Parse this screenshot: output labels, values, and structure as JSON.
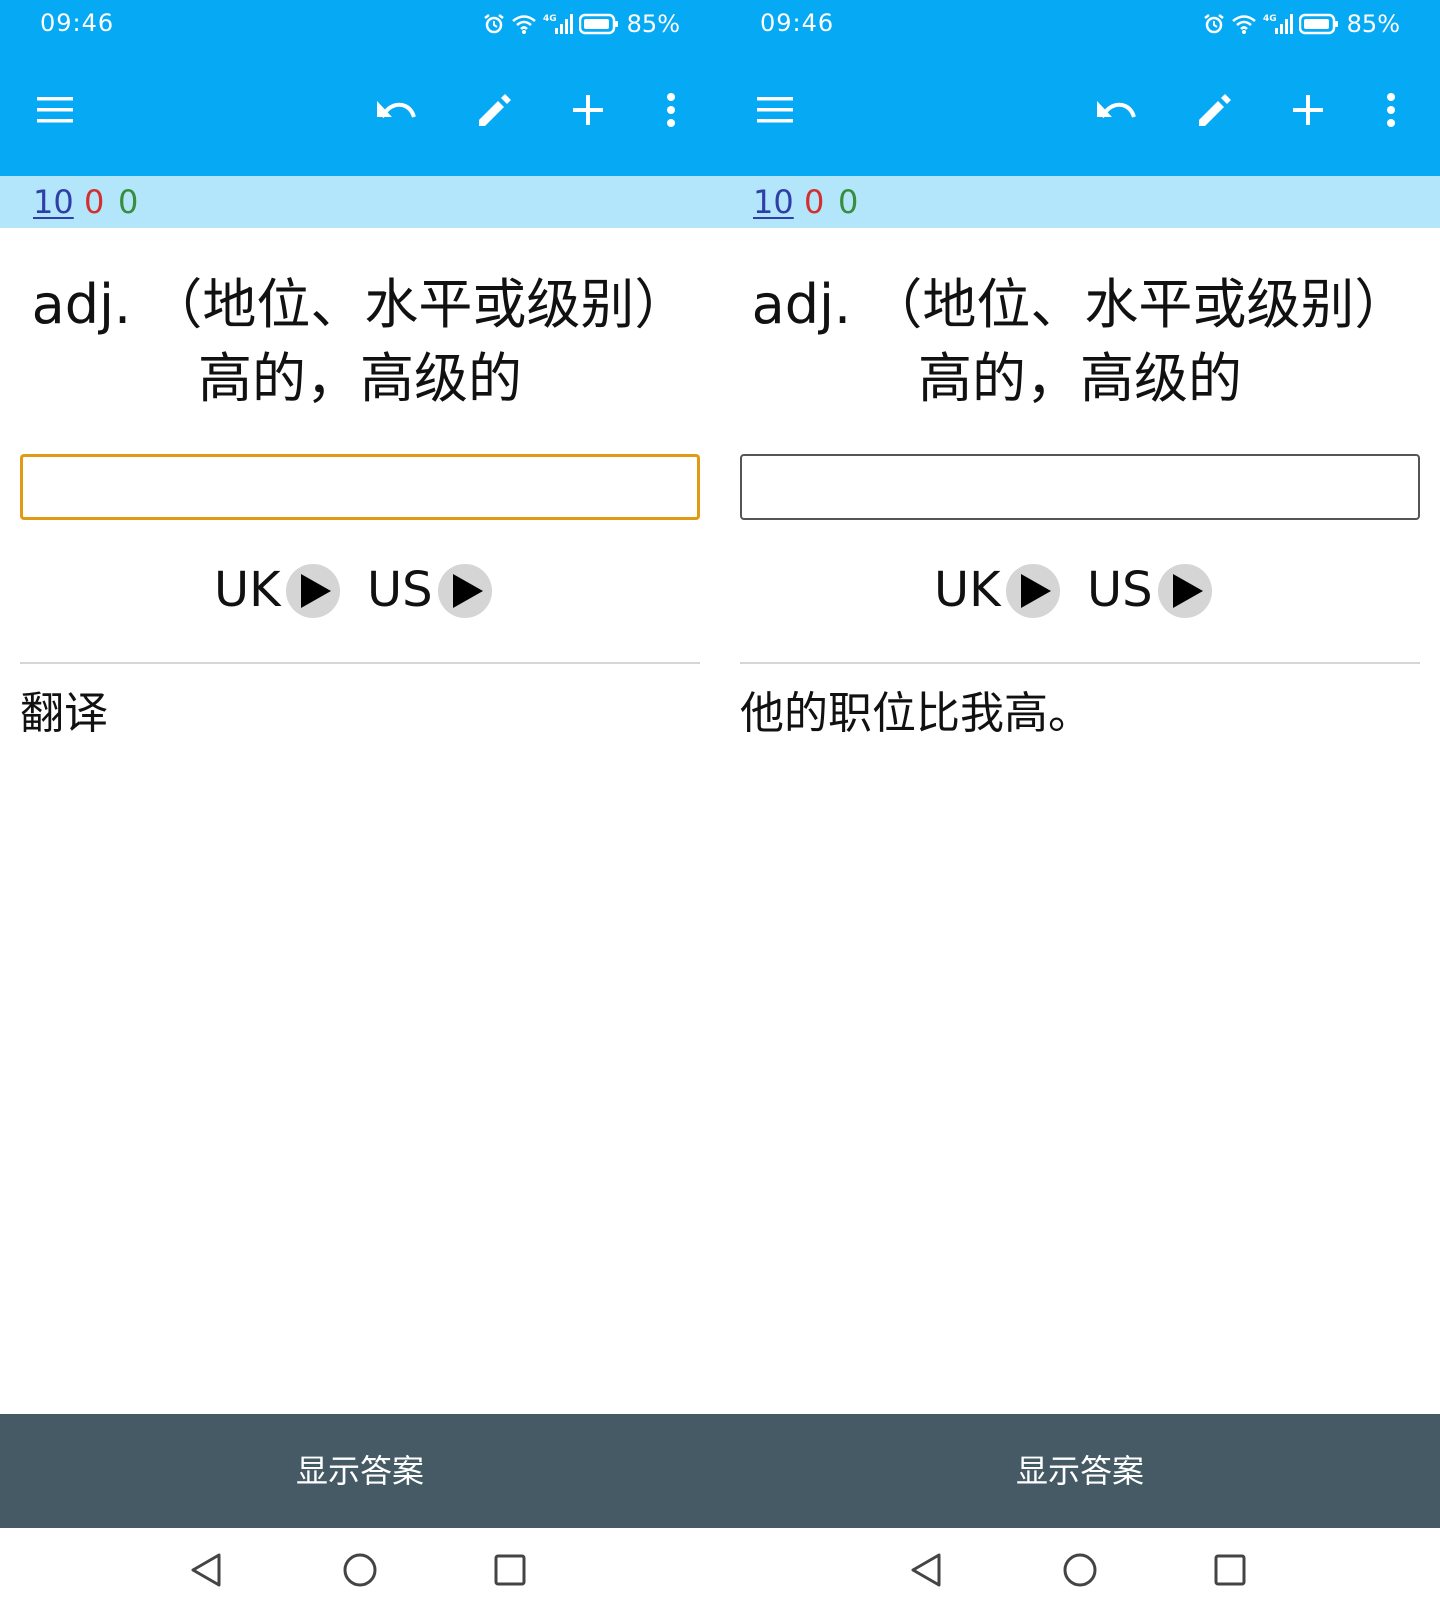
{
  "screens": [
    {
      "status": {
        "time": "09:46",
        "battery": "85%",
        "network": "4G"
      },
      "counts": {
        "new": "10",
        "learning": "0",
        "review": "0"
      },
      "card": {
        "definition_line1": "adj. （地位、水平或级别）",
        "definition_line2": "高的，高级的",
        "answer_value": "",
        "audio_uk": "UK",
        "audio_us": "US",
        "sentence": "翻译"
      },
      "show_answer_label": "显示答案"
    },
    {
      "status": {
        "time": "09:46",
        "battery": "85%",
        "network": "4G"
      },
      "counts": {
        "new": "10",
        "learning": "0",
        "review": "0"
      },
      "card": {
        "definition_line1": "adj. （地位、水平或级别）",
        "definition_line2": "高的，高级的",
        "answer_value": "",
        "audio_uk": "UK",
        "audio_us": "US",
        "sentence": "他的职位比我高。"
      },
      "show_answer_label": "显示答案"
    }
  ],
  "icons": {
    "menu": "menu-icon",
    "undo": "undo-icon",
    "edit": "pencil-icon",
    "add": "plus-icon",
    "more": "more-vertical-icon",
    "play": "play-icon",
    "back": "nav-back-icon",
    "home": "nav-home-icon",
    "recents": "nav-recents-icon"
  },
  "colors": {
    "appbar": "#05A9F4",
    "count_bar": "#B3E5FB",
    "count_new": "#2F3EA8",
    "count_learning": "#D32F2F",
    "count_review": "#388E3C",
    "focus_border": "#E29A14",
    "show_answer_bg": "#455A64"
  }
}
